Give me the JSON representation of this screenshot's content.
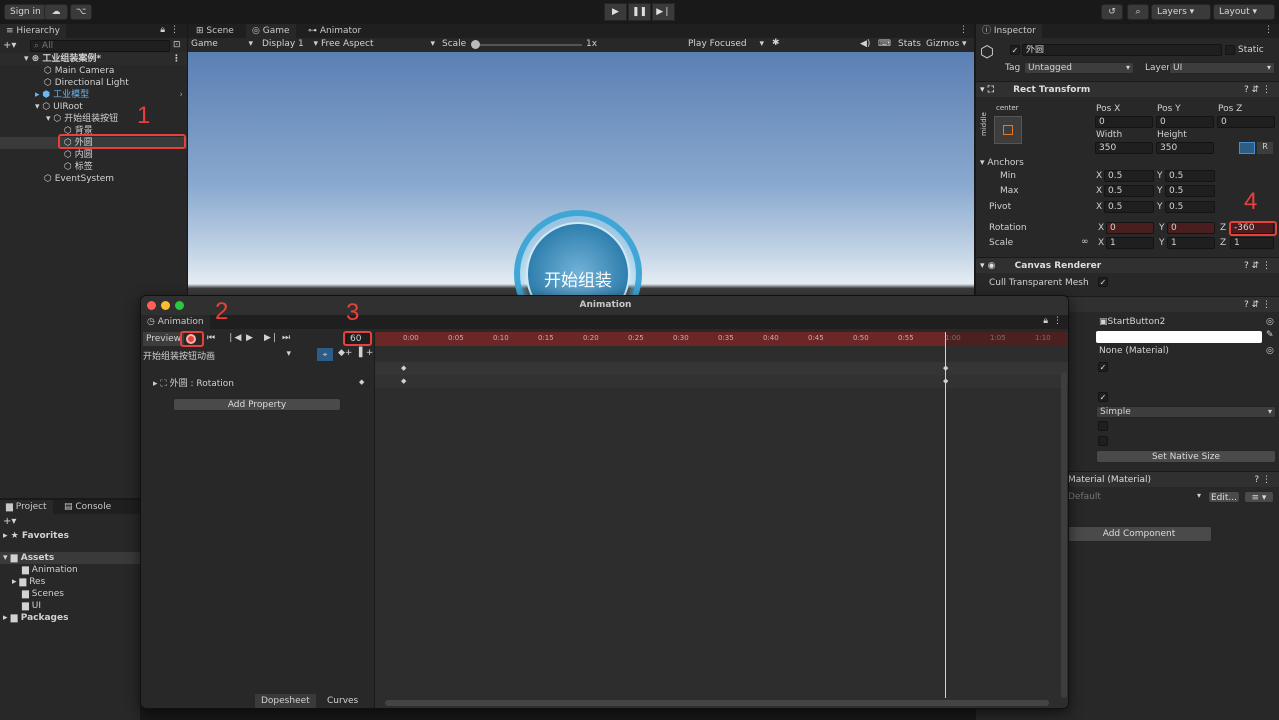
{
  "toolbar": {
    "sign_in": "Sign in",
    "layers": "Layers",
    "layout": "Layout"
  },
  "hierarchy": {
    "tab": "Hierarchy",
    "search_placeholder": "All",
    "scene": "工业组装案例*",
    "items": [
      "Main Camera",
      "Directional Light",
      "工业模型",
      "UIRoot",
      "开始组装按钮",
      "背景",
      "外圆",
      "内圆",
      "标签",
      "EventSystem"
    ]
  },
  "scene_tabs": [
    "Scene",
    "Game",
    "Animator"
  ],
  "game_bar": {
    "game": "Game",
    "display": "Display 1",
    "aspect": "Free Aspect",
    "scale_label": "Scale",
    "scale_value": "1x",
    "play_focused": "Play Focused",
    "stats": "Stats",
    "gizmos": "Gizmos"
  },
  "game_view": {
    "button_text": "开始组装"
  },
  "project": {
    "tabs": [
      "Project",
      "Console"
    ],
    "favorites": "Favorites",
    "assets": "Assets",
    "folders": [
      "Animation",
      "Res",
      "Scenes",
      "UI"
    ],
    "packages": "Packages"
  },
  "inspector": {
    "tab": "Inspector",
    "name": "外圆",
    "static": "Static",
    "tag_label": "Tag",
    "tag_value": "Untagged",
    "layer_label": "Layer",
    "layer_value": "UI",
    "rect_transform": "Rect Transform",
    "anchor_h": "center",
    "anchor_v": "middle",
    "pos_x_label": "Pos X",
    "pos_y_label": "Pos Y",
    "pos_z_label": "Pos Z",
    "pos_x": "0",
    "pos_y": "0",
    "pos_z": "0",
    "width_label": "Width",
    "height_label": "Height",
    "width": "350",
    "height": "350",
    "anchors": "Anchors",
    "min": "Min",
    "max": "Max",
    "pivot": "Pivot",
    "min_x": "0.5",
    "min_y": "0.5",
    "max_x": "0.5",
    "max_y": "0.5",
    "pivot_x": "0.5",
    "pivot_y": "0.5",
    "rotation": "Rotation",
    "rot_x": "0",
    "rot_y": "0",
    "rot_z": "-360",
    "scale": "Scale",
    "scale_x": "1",
    "scale_y": "1",
    "scale_z": "1",
    "canvas_renderer": "Canvas Renderer",
    "cull": "Cull Transparent Mesh",
    "source_image": "StartButton2",
    "material": "None (Material)",
    "image_type": "Simple",
    "native_size": "Set Native Size",
    "material_section": "Material (Material)",
    "shader": "Default",
    "edit": "Edit...",
    "add_component": "Add Component",
    "letter_x": "X",
    "letter_y": "Y",
    "letter_z": "Z",
    "letter_r": "R"
  },
  "animation": {
    "title": "Animation",
    "tab": "Animation",
    "preview": "Preview",
    "frame": "60",
    "clip": "开始组装按钮动画",
    "property": "外圆 : Rotation",
    "add_property": "Add Property",
    "dopesheet": "Dopesheet",
    "curves": "Curves",
    "ticks": [
      "0:00",
      "0:05",
      "0:10",
      "0:15",
      "0:20",
      "0:25",
      "0:30",
      "0:35",
      "0:40",
      "0:45",
      "0:50",
      "0:55",
      "1:00",
      "1:05",
      "1:10"
    ]
  },
  "annotations": [
    "1",
    "2",
    "3",
    "4"
  ],
  "colors": {
    "accent": "#e8413b",
    "record_range": "#6b2626",
    "selection": "#2c5d87"
  }
}
